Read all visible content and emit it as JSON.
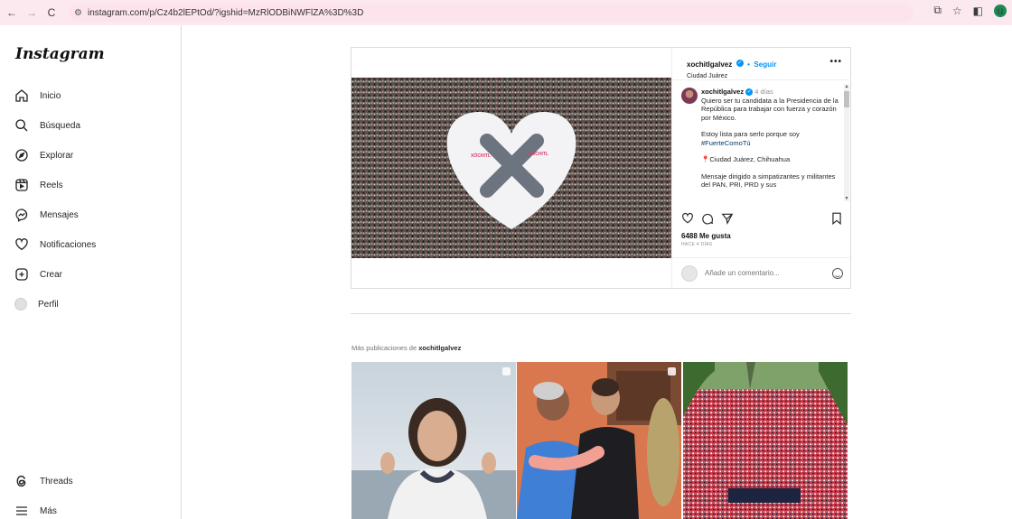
{
  "browser": {
    "url": "instagram.com/p/Cz4b2lEPtOd/?igshid=MzRlODBiNWFlZA%3D%3D",
    "profile_initial": "u"
  },
  "sidebar": {
    "logo": "Instagram",
    "items": [
      {
        "label": "Inicio",
        "icon": "home-icon"
      },
      {
        "label": "Búsqueda",
        "icon": "search-icon"
      },
      {
        "label": "Explorar",
        "icon": "compass-icon"
      },
      {
        "label": "Reels",
        "icon": "reels-icon"
      },
      {
        "label": "Mensajes",
        "icon": "messenger-icon"
      },
      {
        "label": "Notificaciones",
        "icon": "heart-icon"
      },
      {
        "label": "Crear",
        "icon": "plus-square-icon"
      },
      {
        "label": "Perfil",
        "icon": "avatar"
      }
    ],
    "bottom_items": [
      {
        "label": "Threads",
        "icon": "threads-icon"
      },
      {
        "label": "Más",
        "icon": "menu-icon"
      }
    ]
  },
  "post": {
    "username": "xochitlgalvez",
    "follow_label": "Seguir",
    "location": "Ciudad Juárez",
    "caption": {
      "username": "xochitlgalvez",
      "time": "4 días",
      "line1": "Quiero ser tu candidata a la Presidencia de la República para trabajar con fuerza y corazón por México.",
      "line2": "Estoy lista para serlo porque soy",
      "hashtag": "#FuerteComoTú",
      "line3": "📍Ciudad Juárez, Chihuahua",
      "line4": "Mensaje dirigido a simpatizantes y militantes del PAN, PRI, PRD y sus"
    },
    "likes": "6488 Me gusta",
    "time_ago": "HACE 4 DÍAS",
    "comment_placeholder": "Añade un comentario...",
    "colors": {
      "verified": "#0095f6",
      "link": "#0095f6"
    }
  },
  "more_posts": {
    "prefix": "Más publicaciones de",
    "username": "xochitlgalvez"
  }
}
